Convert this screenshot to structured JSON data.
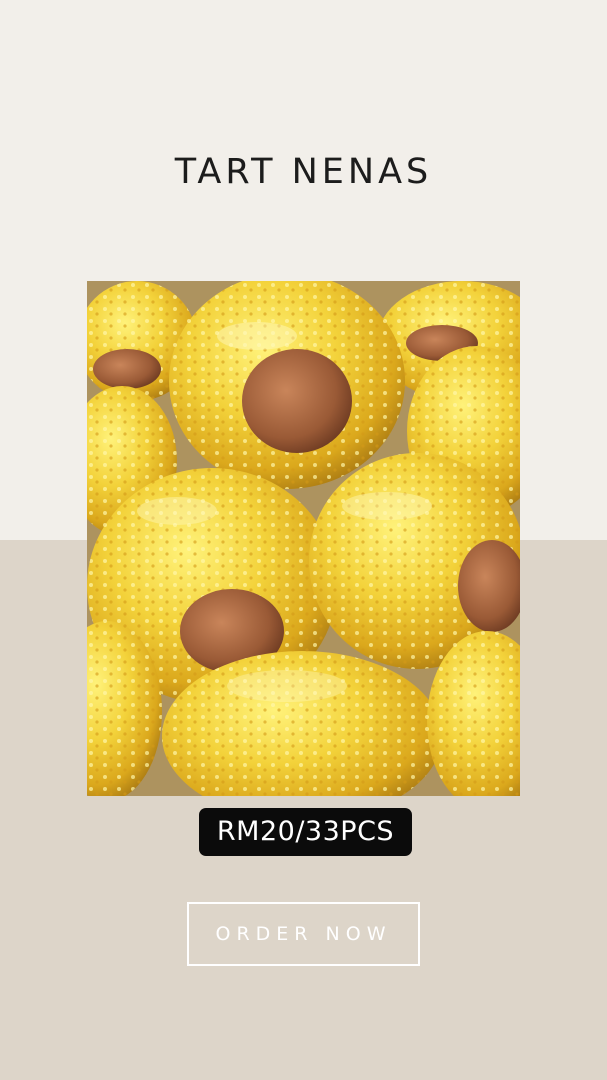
{
  "title": "TART NENAS",
  "price": "RM20/33PCS",
  "cta": "ORDER NOW",
  "colors": {
    "top_background": "#f2efea",
    "bottom_background": "#ddd5c9",
    "price_badge": "#0b0b0b",
    "cta_border": "#ffffff"
  }
}
